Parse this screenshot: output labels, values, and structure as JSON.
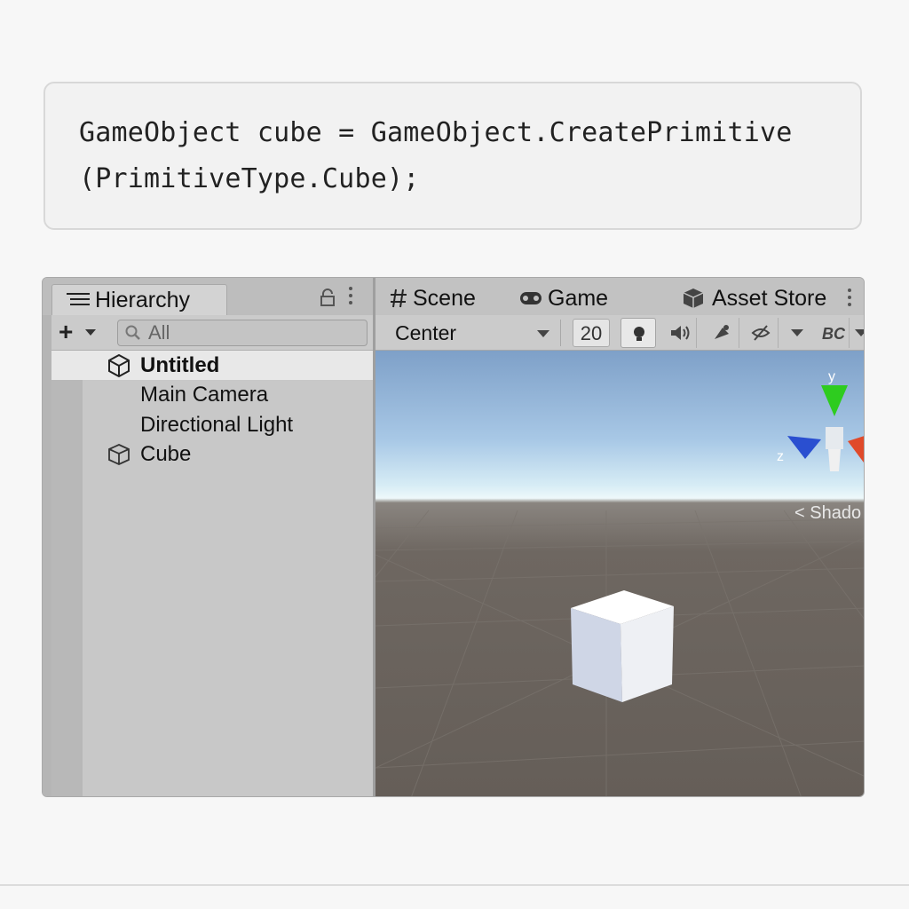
{
  "code": {
    "line1": "GameObject cube = GameObject.CreatePrimitive",
    "line2": "(PrimitiveType.Cube);"
  },
  "hierarchy": {
    "tab_label": "Hierarchy",
    "search_placeholder": "All",
    "items": [
      {
        "label": "Untitled",
        "icon": "unity-scene-icon",
        "selected": true
      },
      {
        "label": "Main Camera"
      },
      {
        "label": "Directional Light"
      },
      {
        "label": "Cube",
        "icon": "cube-icon"
      }
    ]
  },
  "scene": {
    "tabs": [
      {
        "label": "Scene",
        "icon": "scene-hash-icon"
      },
      {
        "label": "Game",
        "icon": "gamepad-icon"
      },
      {
        "label": "Asset Store",
        "icon": "asset-store-icon"
      }
    ],
    "pivot_mode": "Center",
    "zoom_value": "20",
    "overlay_label": "< Shado"
  },
  "colors": {
    "selected_row": "#e8e8e8",
    "panel_bg": "#c8c8c8",
    "gizmo_y": "#2ecc1f",
    "gizmo_x": "#e04a2a",
    "gizmo_z": "#2a4fd0"
  }
}
